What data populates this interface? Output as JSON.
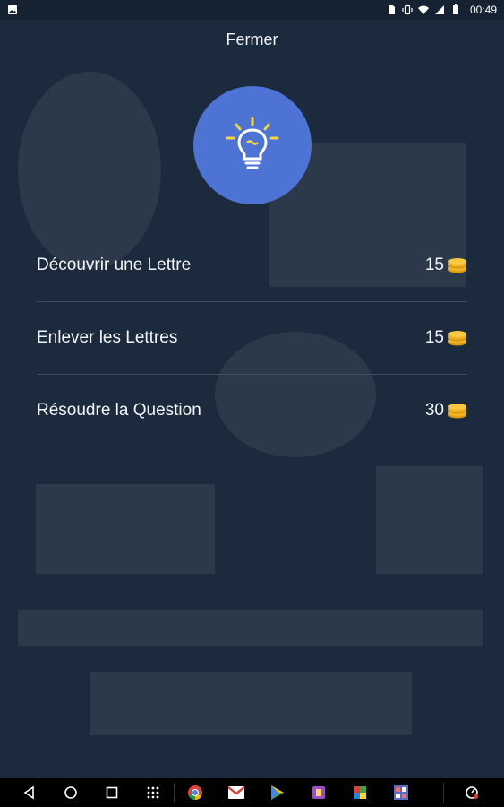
{
  "status_bar": {
    "time": "00:49",
    "icons": [
      "image-icon",
      "sim-icon",
      "vibrate-icon",
      "wifi-icon",
      "signal-icon",
      "battery-icon"
    ]
  },
  "close_label": "Fermer",
  "hints": [
    {
      "label": "Découvrir une Lettre",
      "price": "15"
    },
    {
      "label": "Enlever les Lettres",
      "price": "15"
    },
    {
      "label": "Résoudre la Question",
      "price": "30"
    }
  ],
  "colors": {
    "background": "#1b2a3c",
    "bulb_circle": "#4d73d5",
    "bulb_yellow": "#f5d53a",
    "coin_gold": "#f2b321",
    "divider": "#3d4e61"
  },
  "nav_bar": {
    "buttons": [
      "back-icon",
      "home-icon",
      "recents-icon",
      "app-drawer-icon"
    ],
    "apps": [
      "chrome-icon",
      "gmail-icon",
      "play-store-icon",
      "app-icon-1",
      "app-icon-2",
      "app-icon-3"
    ],
    "extra": "screen-timer-icon"
  }
}
